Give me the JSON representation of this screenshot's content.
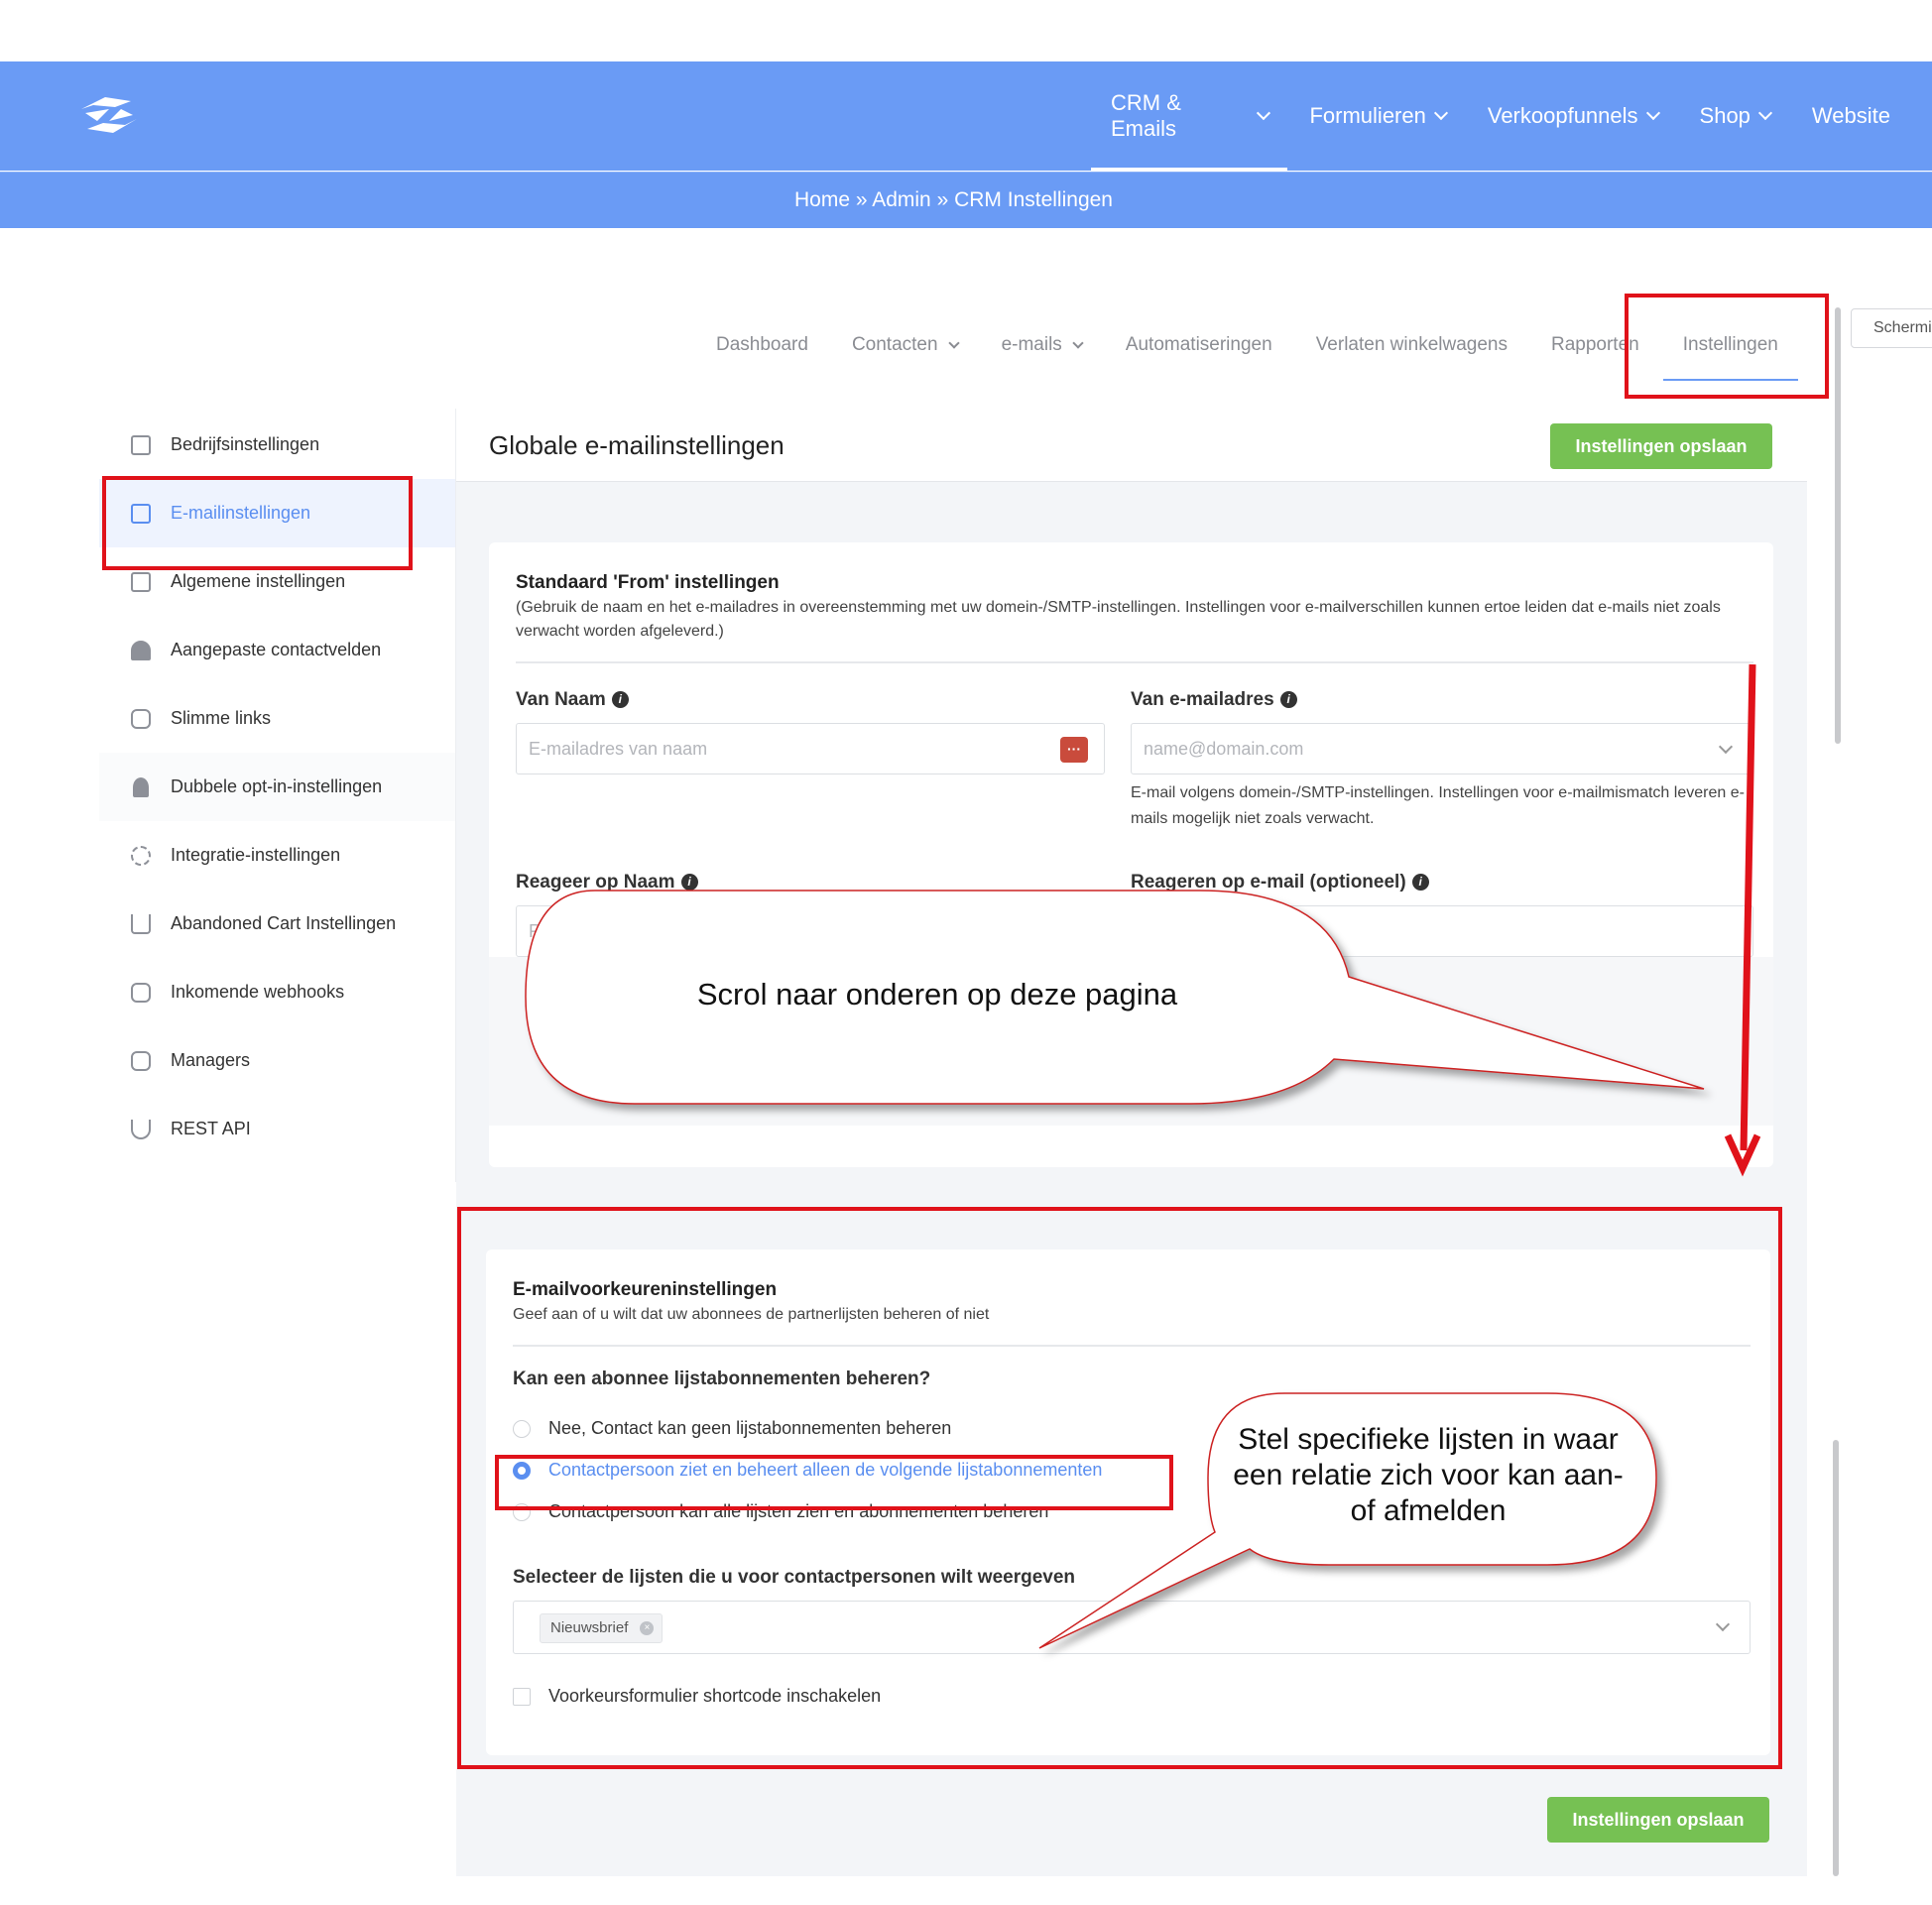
{
  "header": {
    "nav": [
      {
        "label": "CRM & Emails",
        "has_chevron": true,
        "active": true
      },
      {
        "label": "Formulieren",
        "has_chevron": true
      },
      {
        "label": "Verkoopfunnels",
        "has_chevron": true
      },
      {
        "label": "Shop",
        "has_chevron": true
      },
      {
        "label": "Website",
        "has_chevron": false
      }
    ],
    "breadcrumb": "Home » Admin » CRM Instellingen",
    "accent_color": "#6a9bf5"
  },
  "tabs": [
    {
      "label": "Dashboard"
    },
    {
      "label": "Contacten",
      "has_chevron": true
    },
    {
      "label": "e-mails",
      "has_chevron": true
    },
    {
      "label": "Automatiseringen"
    },
    {
      "label": "Verlaten winkelwagens"
    },
    {
      "label": "Rapporten"
    },
    {
      "label": "Instellingen",
      "active": true
    }
  ],
  "scherm_button": "Schermi",
  "sidebar": {
    "items": [
      {
        "label": "Bedrijfsinstellingen",
        "icon": "document-icon"
      },
      {
        "label": "E-mailinstellingen",
        "icon": "envelope-icon",
        "active": true
      },
      {
        "label": "Algemene instellingen",
        "icon": "settings-list-icon"
      },
      {
        "label": "Aangepaste contactvelden",
        "icon": "user-icon"
      },
      {
        "label": "Slimme links",
        "icon": "link-icon"
      },
      {
        "label": "Dubbele opt-in-instellingen",
        "icon": "stamp-icon"
      },
      {
        "label": "Integratie-instellingen",
        "icon": "gear-icon"
      },
      {
        "label": "Abandoned Cart Instellingen",
        "icon": "cart-icon"
      },
      {
        "label": "Inkomende webhooks",
        "icon": "link-icon"
      },
      {
        "label": "Managers",
        "icon": "link-icon"
      },
      {
        "label": "REST API",
        "icon": "magnet-icon"
      }
    ]
  },
  "main": {
    "title": "Globale e-mailinstellingen",
    "save_label": "Instellingen opslaan",
    "from_section": {
      "title": "Standaard 'From' instellingen",
      "description": "(Gebruik de naam en het e-mailadres in overeenstemming met uw domein-/SMTP-instellingen. Instellingen voor e-mailverschillen kunnen ertoe leiden dat e-mails niet zoals verwacht worden afgeleverd.)",
      "from_name_label": "Van Naam",
      "from_name_placeholder": "E-mailadres van naam",
      "from_email_label": "Van e-mailadres",
      "from_email_placeholder": "name@domain.com",
      "from_email_help": "E-mail volgens domein-/SMTP-instellingen. Instellingen voor e-mailmismatch leveren e-mails mogelijk niet zoals verwacht.",
      "reply_name_label": "Reageer op Naam",
      "reply_name_placeholder_visible": "Re",
      "reply_email_label": "Reageren op e-mail (optioneel)"
    },
    "pref_section": {
      "title": "E-mailvoorkeureninstellingen",
      "description": "Geef aan of u wilt dat uw abonnees de partnerlijsten beheren of niet",
      "question": "Kan een abonnee lijstabonnementen beheren?",
      "options": [
        {
          "label": "Nee, Contact kan geen lijstabonnementen beheren",
          "selected": false
        },
        {
          "label": "Contactpersoon ziet en beheert alleen de volgende lijstabonnementen",
          "selected": true
        },
        {
          "label": "Contactpersoon kan alle lijsten zien en abonnementen beheren",
          "selected": false
        }
      ],
      "select_label": "Selecteer de lijsten die u voor contactpersonen wilt weergeven",
      "selected_tags": [
        "Nieuwsbrief"
      ],
      "shortcode_label": "Voorkeursformulier shortcode inschakelen",
      "shortcode_checked": false
    }
  },
  "annotations": {
    "callout_scroll": "Scrol naar onderen op deze pagina",
    "callout_lists": "Stel specifieke lijsten in waar een relatie zich voor kan aan- of afmelden",
    "highlight_color": "#e0121a"
  }
}
